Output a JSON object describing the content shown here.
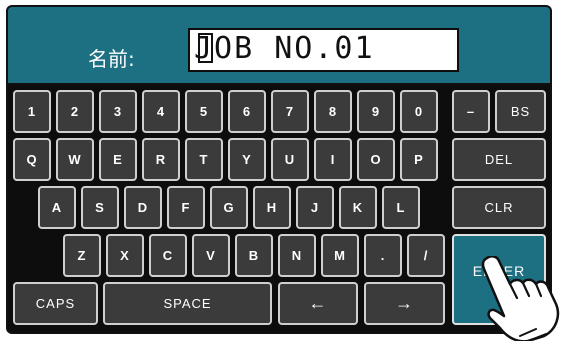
{
  "header": {
    "name_label": "名前:",
    "name_value": "JOB NO.01"
  },
  "keys": {
    "row1": [
      "1",
      "2",
      "3",
      "4",
      "5",
      "6",
      "7",
      "8",
      "9",
      "0",
      "–"
    ],
    "bs": "BS",
    "row2": [
      "Q",
      "W",
      "E",
      "R",
      "T",
      "Y",
      "U",
      "I",
      "O",
      "P"
    ],
    "del": "DEL",
    "row3": [
      "A",
      "S",
      "D",
      "F",
      "G",
      "H",
      "J",
      "K",
      "L"
    ],
    "clr": "CLR",
    "row4": [
      "Z",
      "X",
      "C",
      "V",
      "B",
      "N",
      "M",
      ".",
      "/"
    ],
    "enter": "ENTER",
    "caps": "CAPS",
    "space": "SPACE",
    "left": "←",
    "right": "→"
  },
  "colors": {
    "header_bg": "#1d6f82",
    "key_bg": "#3b3b3b",
    "enter_bg": "#1d6f82",
    "panel_bg": "#0d0d0d"
  },
  "icons": {
    "pointer": "hand-pointer-icon"
  }
}
